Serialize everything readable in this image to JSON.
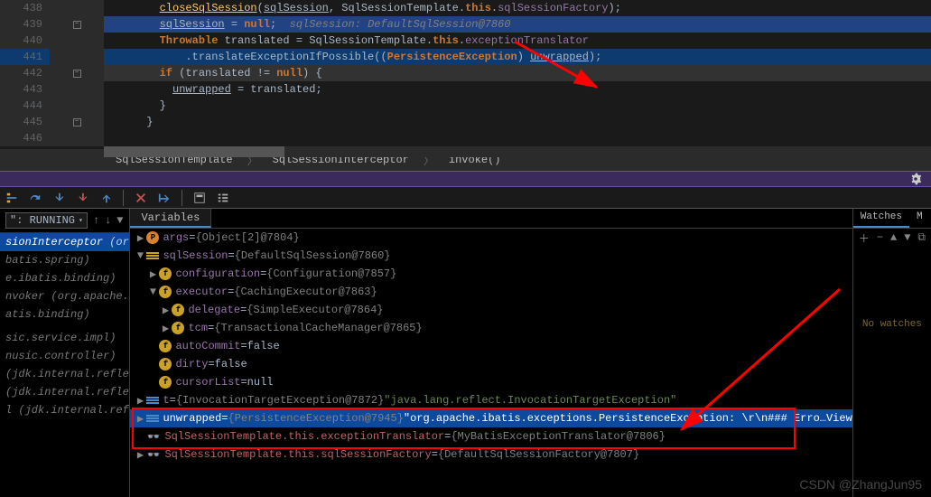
{
  "editor": {
    "lines": [
      {
        "n": "438",
        "html": "        <span class='m u'>closeSqlSession</span>(<span class='u'>sqlSession</span>, SqlSessionTemplate.<span class='k'>this</span>.<span class='f'>sqlSessionFactory</span>);",
        "cls": ""
      },
      {
        "n": "439",
        "html": "        <span class='u'>sqlSession</span> = <span class='k'>null</span>;  <span class='s'>sqlSession: DefaultSqlSession@7860</span>",
        "cls": "hl-dblue"
      },
      {
        "n": "440",
        "html": "        <span class='k'>Throwable</span> translated = SqlSessionTemplate.<span class='k'>this</span>.<span class='f'>exceptionTranslator</span>",
        "cls": ""
      },
      {
        "n": "441",
        "html": "            .translateExceptionIfPossible((<span class='k'>PersistenceException</span>) <span class='u'>unwrapped</span>);",
        "cls": "hl-lblue",
        "cur": true
      },
      {
        "n": "442",
        "html": "        <span class='k'>if</span> (translated != <span class='k'>null</span>) {",
        "cls": "hl-cur"
      },
      {
        "n": "443",
        "html": "          <span class='u'>unwrapped</span> = translated;",
        "cls": ""
      },
      {
        "n": "444",
        "html": "        }",
        "cls": ""
      },
      {
        "n": "445",
        "html": "      }",
        "cls": ""
      },
      {
        "n": "446",
        "html": "",
        "cls": ""
      }
    ]
  },
  "breadcrumb": {
    "a": "SqlSessionTemplate",
    "b": "SqlSessionInterceptor",
    "c": "invoke()"
  },
  "frames": {
    "status": "\": RUNNING",
    "selected": {
      "method": "sionInterceptor",
      "pkg": "(org.mybatis.spring)"
    },
    "list": [
      "batis.spring)",
      "e.ibatis.binding)",
      "nvoker (org.apache.ibatis.binding",
      "atis.binding)",
      "",
      "sic.service.impl)",
      "nusic.controller)",
      "(jdk.internal.reflect)",
      "(jdk.internal.reflect)",
      "l (jdk.internal.reflect)"
    ]
  },
  "tabs": {
    "vars": "Variables",
    "watches": "Watches",
    "mem": "M"
  },
  "vars": [
    {
      "d": 0,
      "tw": "▶",
      "ico": "p",
      "name": "args",
      "eq": " = ",
      "val": "{Object[2]@7804}",
      "cls": ""
    },
    {
      "d": 0,
      "tw": "▼",
      "ico": "bars",
      "name": "sqlSession",
      "eq": " = ",
      "val": "{DefaultSqlSession@7860}",
      "cls": ""
    },
    {
      "d": 1,
      "tw": "▶",
      "ico": "f",
      "name": "configuration",
      "eq": " = ",
      "val": "{Configuration@7857}",
      "cls": ""
    },
    {
      "d": 1,
      "tw": "▼",
      "ico": "f",
      "name": "executor",
      "eq": " = ",
      "val": "{CachingExecutor@7863}",
      "cls": ""
    },
    {
      "d": 2,
      "tw": "▶",
      "ico": "f",
      "name": "delegate",
      "eq": " = ",
      "val": "{SimpleExecutor@7864}",
      "cls": ""
    },
    {
      "d": 2,
      "tw": "▶",
      "ico": "f",
      "name": "tcm",
      "eq": " = ",
      "val": "{TransactionalCacheManager@7865}",
      "cls": ""
    },
    {
      "d": 1,
      "tw": "",
      "ico": "f",
      "name": "autoCommit",
      "eq": " = ",
      "val": "false",
      "cls": "",
      "plain": true
    },
    {
      "d": 1,
      "tw": "",
      "ico": "f",
      "name": "dirty",
      "eq": " = ",
      "val": "false",
      "cls": "",
      "plain": true
    },
    {
      "d": 1,
      "tw": "",
      "ico": "f",
      "name": "cursorList",
      "eq": " = ",
      "val": "null",
      "cls": "",
      "plain": true
    },
    {
      "d": 0,
      "tw": "▶",
      "ico": "bars-bl",
      "name": "t",
      "eq": " = ",
      "val": "{InvocationTargetException@7872}",
      "str": " \"java.lang.reflect.InvocationTargetException\"",
      "cls": ""
    },
    {
      "d": 0,
      "tw": "▶",
      "ico": "bars-bl",
      "name": "unwrapped",
      "eq": " = ",
      "val": "{PersistenceException@7945}",
      "str": " \"org.apache.ibatis.exceptions.PersistenceException: \\r\\n### Erro…",
      "view": " View",
      "cls": "sel"
    },
    {
      "d": 0,
      "tw": "",
      "ico": "glasses",
      "name": "SqlSessionTemplate.this.exceptionTranslator",
      "eq": " = ",
      "val": "{MyBatisExceptionTranslator@7806}",
      "cls": "",
      "red": true
    },
    {
      "d": 0,
      "tw": "▶",
      "ico": "glasses",
      "name": "SqlSessionTemplate.this.sqlSessionFactory",
      "eq": " = ",
      "val": "{DefaultSqlSessionFactory@7807}",
      "cls": "",
      "red": true
    }
  ],
  "watches": {
    "empty": "No watches"
  },
  "watermark": "CSDN @ZhangJun95"
}
